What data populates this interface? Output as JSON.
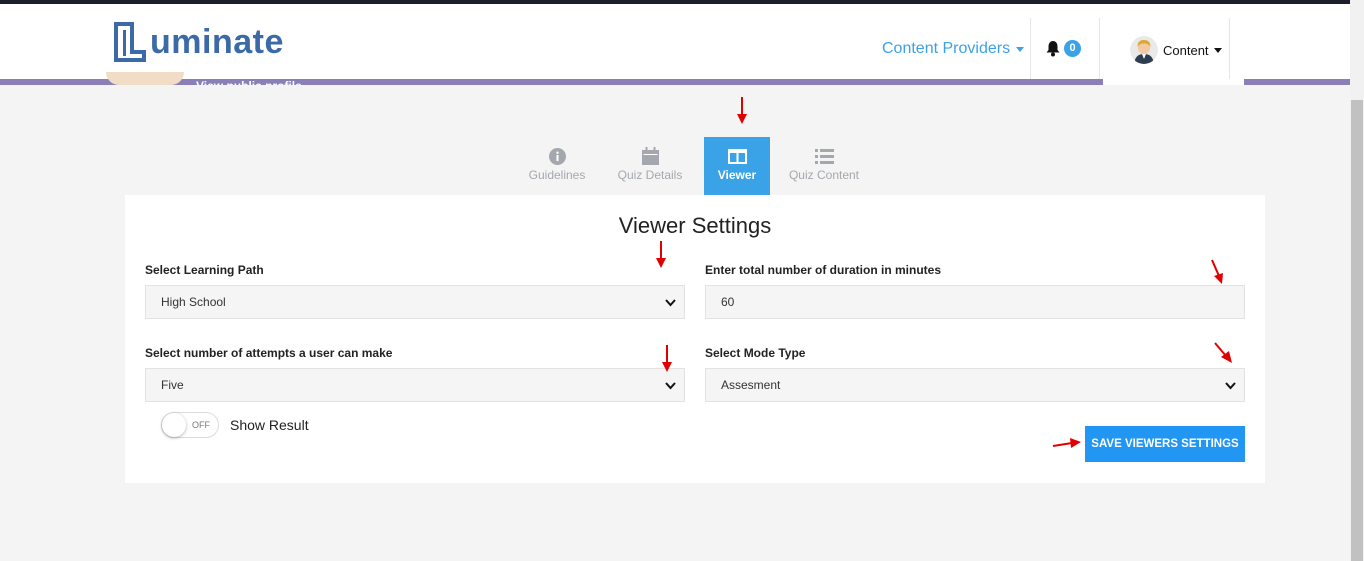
{
  "header": {
    "logo_text": "uminate",
    "profile_link_text": "View public profile",
    "nav_providers_label": "Content Providers",
    "notifications_count": "0",
    "user_label": "Content"
  },
  "tabs": [
    {
      "label": "Guidelines",
      "icon": "info-circle-icon",
      "active": false
    },
    {
      "label": "Quiz Details",
      "icon": "calendar-icon",
      "active": false
    },
    {
      "label": "Viewer",
      "icon": "columns-icon",
      "active": true
    },
    {
      "label": "Quiz Content",
      "icon": "list-icon",
      "active": false
    }
  ],
  "form": {
    "title": "Viewer Settings",
    "learning_path": {
      "label": "Select Learning Path",
      "value": "High School"
    },
    "duration": {
      "label": "Enter total number of duration in minutes",
      "value": "60"
    },
    "attempts": {
      "label": "Select number of attempts a user can make",
      "value": "Five"
    },
    "mode": {
      "label": "Select Mode Type",
      "value": "Assesment"
    },
    "show_result": {
      "toggle_state": "OFF",
      "label": "Show Result"
    },
    "save_label": "SAVE VIEWERS SETTINGS"
  },
  "colors": {
    "accent": "#3aa2e6",
    "button": "#2196f3",
    "header_strip": "#8a7fb6",
    "annotation_arrow": "#e00000"
  }
}
